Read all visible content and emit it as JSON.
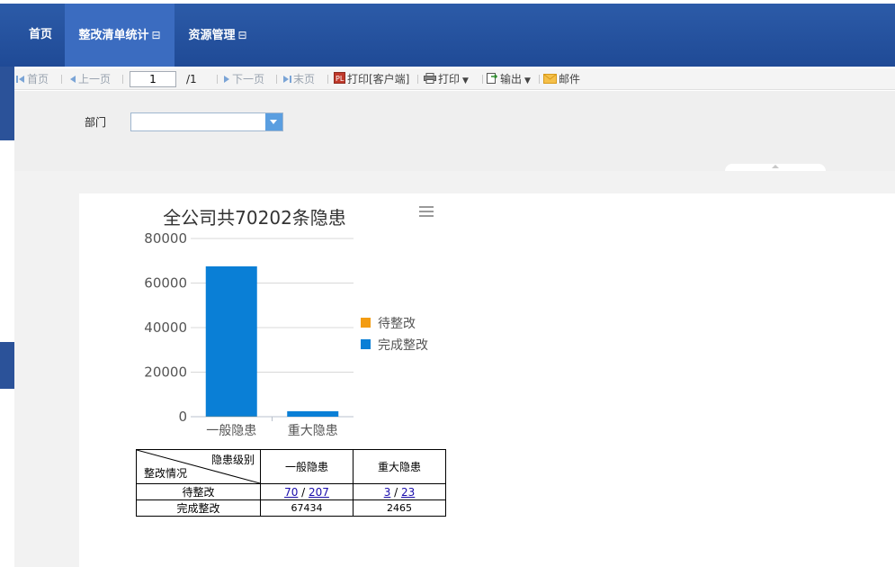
{
  "nav": {
    "items": [
      {
        "label": "首页",
        "toggle": ""
      },
      {
        "label": "整改清单统计",
        "toggle": "⊟"
      },
      {
        "label": "资源管理",
        "toggle": "⊟"
      }
    ]
  },
  "toolbar": {
    "first": "首页",
    "prev": "上一页",
    "page_value": "1",
    "page_total": "/1",
    "next": "下一页",
    "last": "末页",
    "print_client": "打印[客户端]",
    "print": "打印",
    "export": "输出",
    "mail": "邮件"
  },
  "filter": {
    "dept_label": "部门",
    "dept_value": ""
  },
  "colors": {
    "pending": "#f39c12",
    "done": "#0a7fd6",
    "nav": "#2c5ba8"
  },
  "chart_data": {
    "type": "bar",
    "title": "全公司共70202条隐患",
    "categories": [
      "一般隐患",
      "重大隐患"
    ],
    "series": [
      {
        "name": "待整改",
        "values": [
          70,
          3
        ]
      },
      {
        "name": "完成整改",
        "values": [
          67434,
          2465
        ]
      }
    ],
    "stacked": true,
    "ylim": [
      0,
      80000
    ],
    "yticks": [
      "80000",
      "60000",
      "40000",
      "20000",
      "0"
    ],
    "grid": true,
    "legend_position": "right"
  },
  "table": {
    "header_top_right": "隐患级别",
    "header_bottom_left": "整改情况",
    "columns": [
      "一般隐患",
      "重大隐患"
    ],
    "rows": [
      {
        "label": "待整改",
        "cells": [
          {
            "a": "70",
            "sep": " / ",
            "b": "207"
          },
          {
            "a": "3",
            "sep": " / ",
            "b": "23"
          }
        ]
      },
      {
        "label": "完成整改",
        "cells": [
          "67434",
          "2465"
        ]
      }
    ]
  }
}
